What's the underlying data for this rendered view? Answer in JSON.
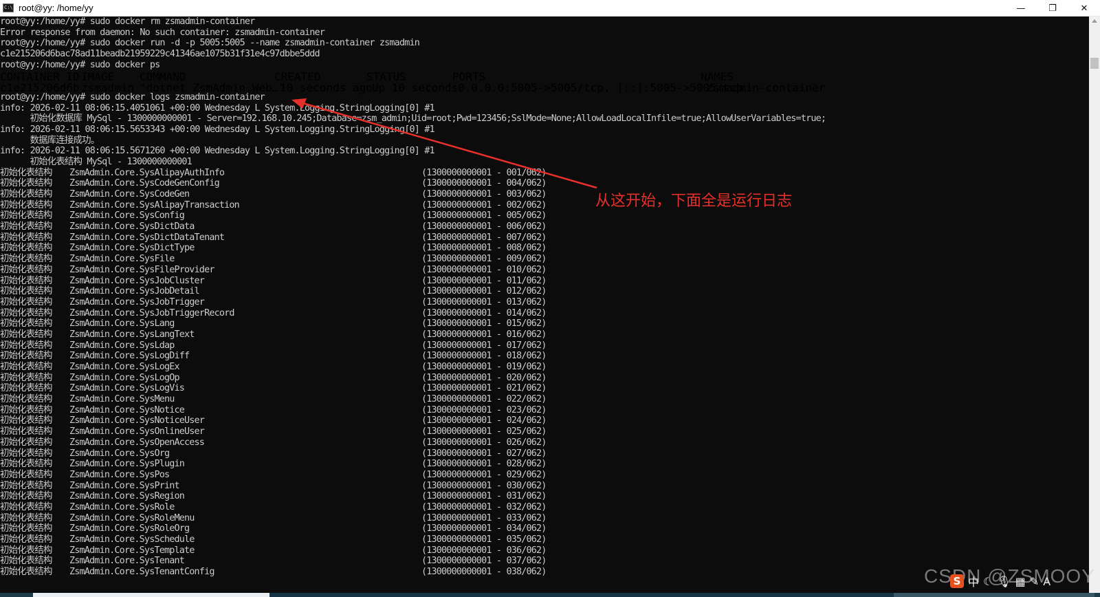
{
  "window": {
    "title": "root@yy: /home/yy",
    "icon_text": "C:\\",
    "minimize_glyph": "—",
    "maximize_glyph": "❐",
    "close_glyph": "✕"
  },
  "console": {
    "lines_head": [
      "root@yy:/home/yy# sudo docker rm zsmadmin-container",
      "Error response from daemon: No such container: zsmadmin-container",
      "root@yy:/home/yy# sudo docker run -d -p 5005:5005 --name zsmadmin-container zsmadmin",
      "c1e215206d6bac78ad11beadb21959229c41346ae1075b31f31e4c97dbbe5ddd",
      "root@yy:/home/yy# sudo docker ps"
    ],
    "ps_table": {
      "headers": [
        "CONTAINER ID",
        "IMAGE",
        "COMMAND",
        "CREATED",
        "STATUS",
        "PORTS",
        "NAMES"
      ],
      "row": [
        "c1e215206d6b",
        "zsmadmin",
        "\"dotnet ZsmAdmin.Web…\"",
        "10 seconds ago",
        "Up 10 seconds",
        "0.0.0.0:5005->5005/tcp, [::]:5005->5005/tcp",
        "zsmadmin-container"
      ]
    },
    "lines_logs": [
      "root@yy:/home/yy# sudo docker logs zsmadmin-container",
      "info: 2026-02-11 08:06:15.4051061 +00:00 Wednesday L System.Logging.StringLogging[0] #1",
      "      初始化数据库 MySql - 1300000000001 - Server=192.168.10.245;Database=zsm_admin;Uid=root;Pwd=123456;SslMode=None;AllowLoadLocalInfile=true;AllowUserVariables=true;",
      "info: 2026-02-11 08:06:15.5653343 +00:00 Wednesday L System.Logging.StringLogging[0] #1",
      "      数据库连接成功。",
      "info: 2026-02-11 08:06:15.5671260 +00:00 Wednesday L System.Logging.StringLogging[0] #1",
      "      初始化表结构 MySql - 1300000000001"
    ],
    "init_prefix": "初始化表结构",
    "init_rows": [
      {
        "name": "ZsmAdmin.Core.SysAlipayAuthInfo",
        "progress": "(1300000000001 - 001/062)"
      },
      {
        "name": "ZsmAdmin.Core.SysCodeGenConfig",
        "progress": "(1300000000001 - 004/062)"
      },
      {
        "name": "ZsmAdmin.Core.SysCodeGen",
        "progress": "(1300000000001 - 003/062)"
      },
      {
        "name": "ZsmAdmin.Core.SysAlipayTransaction",
        "progress": "(1300000000001 - 002/062)"
      },
      {
        "name": "ZsmAdmin.Core.SysConfig",
        "progress": "(1300000000001 - 005/062)"
      },
      {
        "name": "ZsmAdmin.Core.SysDictData",
        "progress": "(1300000000001 - 006/062)"
      },
      {
        "name": "ZsmAdmin.Core.SysDictDataTenant",
        "progress": "(1300000000001 - 007/062)"
      },
      {
        "name": "ZsmAdmin.Core.SysDictType",
        "progress": "(1300000000001 - 008/062)"
      },
      {
        "name": "ZsmAdmin.Core.SysFile",
        "progress": "(1300000000001 - 009/062)"
      },
      {
        "name": "ZsmAdmin.Core.SysFileProvider",
        "progress": "(1300000000001 - 010/062)"
      },
      {
        "name": "ZsmAdmin.Core.SysJobCluster",
        "progress": "(1300000000001 - 011/062)"
      },
      {
        "name": "ZsmAdmin.Core.SysJobDetail",
        "progress": "(1300000000001 - 012/062)"
      },
      {
        "name": "ZsmAdmin.Core.SysJobTrigger",
        "progress": "(1300000000001 - 013/062)"
      },
      {
        "name": "ZsmAdmin.Core.SysJobTriggerRecord",
        "progress": "(1300000000001 - 014/062)"
      },
      {
        "name": "ZsmAdmin.Core.SysLang",
        "progress": "(1300000000001 - 015/062)"
      },
      {
        "name": "ZsmAdmin.Core.SysLangText",
        "progress": "(1300000000001 - 016/062)"
      },
      {
        "name": "ZsmAdmin.Core.SysLdap",
        "progress": "(1300000000001 - 017/062)"
      },
      {
        "name": "ZsmAdmin.Core.SysLogDiff",
        "progress": "(1300000000001 - 018/062)"
      },
      {
        "name": "ZsmAdmin.Core.SysLogEx",
        "progress": "(1300000000001 - 019/062)"
      },
      {
        "name": "ZsmAdmin.Core.SysLogOp",
        "progress": "(1300000000001 - 020/062)"
      },
      {
        "name": "ZsmAdmin.Core.SysLogVis",
        "progress": "(1300000000001 - 021/062)"
      },
      {
        "name": "ZsmAdmin.Core.SysMenu",
        "progress": "(1300000000001 - 022/062)"
      },
      {
        "name": "ZsmAdmin.Core.SysNotice",
        "progress": "(1300000000001 - 023/062)"
      },
      {
        "name": "ZsmAdmin.Core.SysNoticeUser",
        "progress": "(1300000000001 - 024/062)"
      },
      {
        "name": "ZsmAdmin.Core.SysOnlineUser",
        "progress": "(1300000000001 - 025/062)"
      },
      {
        "name": "ZsmAdmin.Core.SysOpenAccess",
        "progress": "(1300000000001 - 026/062)"
      },
      {
        "name": "ZsmAdmin.Core.SysOrg",
        "progress": "(1300000000001 - 027/062)"
      },
      {
        "name": "ZsmAdmin.Core.SysPlugin",
        "progress": "(1300000000001 - 028/062)"
      },
      {
        "name": "ZsmAdmin.Core.SysPos",
        "progress": "(1300000000001 - 029/062)"
      },
      {
        "name": "ZsmAdmin.Core.SysPrint",
        "progress": "(1300000000001 - 030/062)"
      },
      {
        "name": "ZsmAdmin.Core.SysRegion",
        "progress": "(1300000000001 - 031/062)"
      },
      {
        "name": "ZsmAdmin.Core.SysRole",
        "progress": "(1300000000001 - 032/062)"
      },
      {
        "name": "ZsmAdmin.Core.SysRoleMenu",
        "progress": "(1300000000001 - 033/062)"
      },
      {
        "name": "ZsmAdmin.Core.SysRoleOrg",
        "progress": "(1300000000001 - 034/062)"
      },
      {
        "name": "ZsmAdmin.Core.SysSchedule",
        "progress": "(1300000000001 - 035/062)"
      },
      {
        "name": "ZsmAdmin.Core.SysTemplate",
        "progress": "(1300000000001 - 036/062)"
      },
      {
        "name": "ZsmAdmin.Core.SysTenant",
        "progress": "(1300000000001 - 037/062)"
      },
      {
        "name": "ZsmAdmin.Core.SysTenantConfig",
        "progress": "(1300000000001 - 038/062)"
      }
    ]
  },
  "annotation": {
    "text": "从这开始，下面全是运行日志",
    "color": "#e8302a"
  },
  "watermark": {
    "text": "CSDN @ZSMOOY"
  },
  "tray": {
    "app_glyph": "S",
    "ime_label": "中",
    "icons": [
      "moon-icon",
      "mic-icon",
      "keyboard-icon",
      "pen-icon",
      "font-icon"
    ],
    "icon_glyphs": [
      "☾",
      "🎙",
      "▦",
      "✎",
      "A"
    ]
  },
  "colors": {
    "console_bg": "#0c0c0c",
    "console_fg": "#cccccc",
    "annotation_red": "#e8302a"
  }
}
